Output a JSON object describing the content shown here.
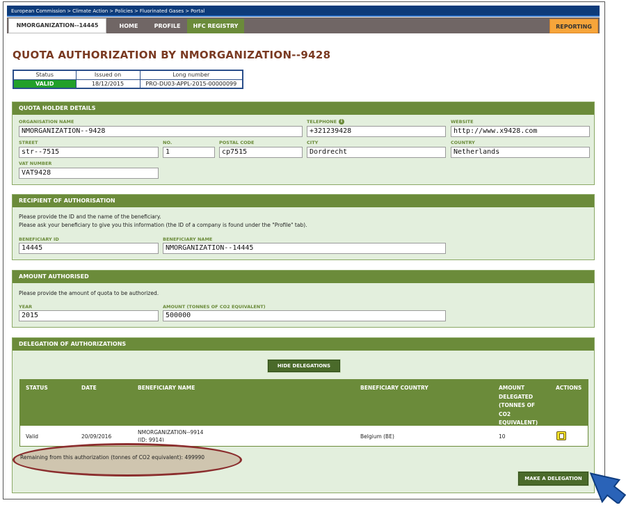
{
  "breadcrumb": [
    "European Commission",
    "Climate Action",
    "Policies",
    "Fluorinated Gases",
    "Portal"
  ],
  "breadcrumb_separator": ">",
  "nav": {
    "org_tab": "NMORGANIZATION--14445",
    "home": "HOME",
    "profile": "PROFILE",
    "hfc_registry": "HFC REGISTRY",
    "reporting": "REPORTING"
  },
  "page_title": "QUOTA AUTHORIZATION BY NMORGANIZATION--9428",
  "status_table": {
    "headers": [
      "Status",
      "Issued on",
      "Long number"
    ],
    "values": [
      "VALID",
      "18/12/2015",
      "PRO-DU03-APPL-2015-00000099"
    ]
  },
  "holder": {
    "title": "QUOTA HOLDER DETAILS",
    "org_name_label": "ORGANISATION NAME",
    "org_name": "NMORGANIZATION--9428",
    "telephone_label": "TELEPHONE",
    "telephone": "+321239428",
    "website_label": "WEBSITE",
    "website": "http://www.x9428.com",
    "street_label": "STREET",
    "street": "str--7515",
    "no_label": "NO.",
    "no": "1",
    "postal_label": "POSTAL CODE",
    "postal": "cp7515",
    "city_label": "CITY",
    "city": "Dordrecht",
    "country_label": "COUNTRY",
    "country": "Netherlands",
    "vat_label": "VAT NUMBER",
    "vat": "VAT9428"
  },
  "recipient": {
    "title": "RECIPIENT OF AUTHORISATION",
    "line1": "Please provide the ID and the name of the beneficiary.",
    "line2": "Please ask your beneficiary to give you this information (the ID of a company is found under the \"Profile\" tab).",
    "id_label": "BENEFICIARY ID",
    "id": "14445",
    "name_label": "BENEFICIARY NAME",
    "name": "NMORGANIZATION--14445"
  },
  "amount": {
    "title": "AMOUNT AUTHORISED",
    "line": "Please provide the amount of quota to be authorized.",
    "year_label": "YEAR",
    "year": "2015",
    "amount_label": "AMOUNT (TONNES OF CO2 EQUIVALENT)",
    "amount": "500000"
  },
  "delegation": {
    "title": "DELEGATION OF AUTHORIZATIONS",
    "hide_button": "HIDE DELEGATIONS",
    "columns": {
      "status": "STATUS",
      "date": "DATE",
      "name": "BENEFICIARY NAME",
      "country": "BENEFICIARY COUNTRY",
      "amount_l1": "AMOUNT",
      "amount_l2": "DELEGATED",
      "amount_l3": "(TONNES OF",
      "amount_l4": "CO2",
      "amount_l5": "EQUIVALENT)",
      "actions": "ACTIONS"
    },
    "row": {
      "status": "Valid",
      "date": "20/09/2016",
      "name": "NMORGANIZATION--9914",
      "id": "(ID: 9914)",
      "country": "Belgium (BE)",
      "amount": "10"
    },
    "remaining": "Remaining from this authorization (tonnes of CO2 equivalent): 499990",
    "make_button": "MAKE A DELEGATION"
  },
  "icons": {
    "info": "info-icon",
    "document": "document-icon",
    "pointer": "arrow-pointer-icon"
  },
  "colors": {
    "brand_green": "#6b8b3a",
    "title_brown": "#7a3a22",
    "valid_green": "#22a02a",
    "reporting_orange": "#f7a53a",
    "arrow_blue": "#2a63b8"
  }
}
